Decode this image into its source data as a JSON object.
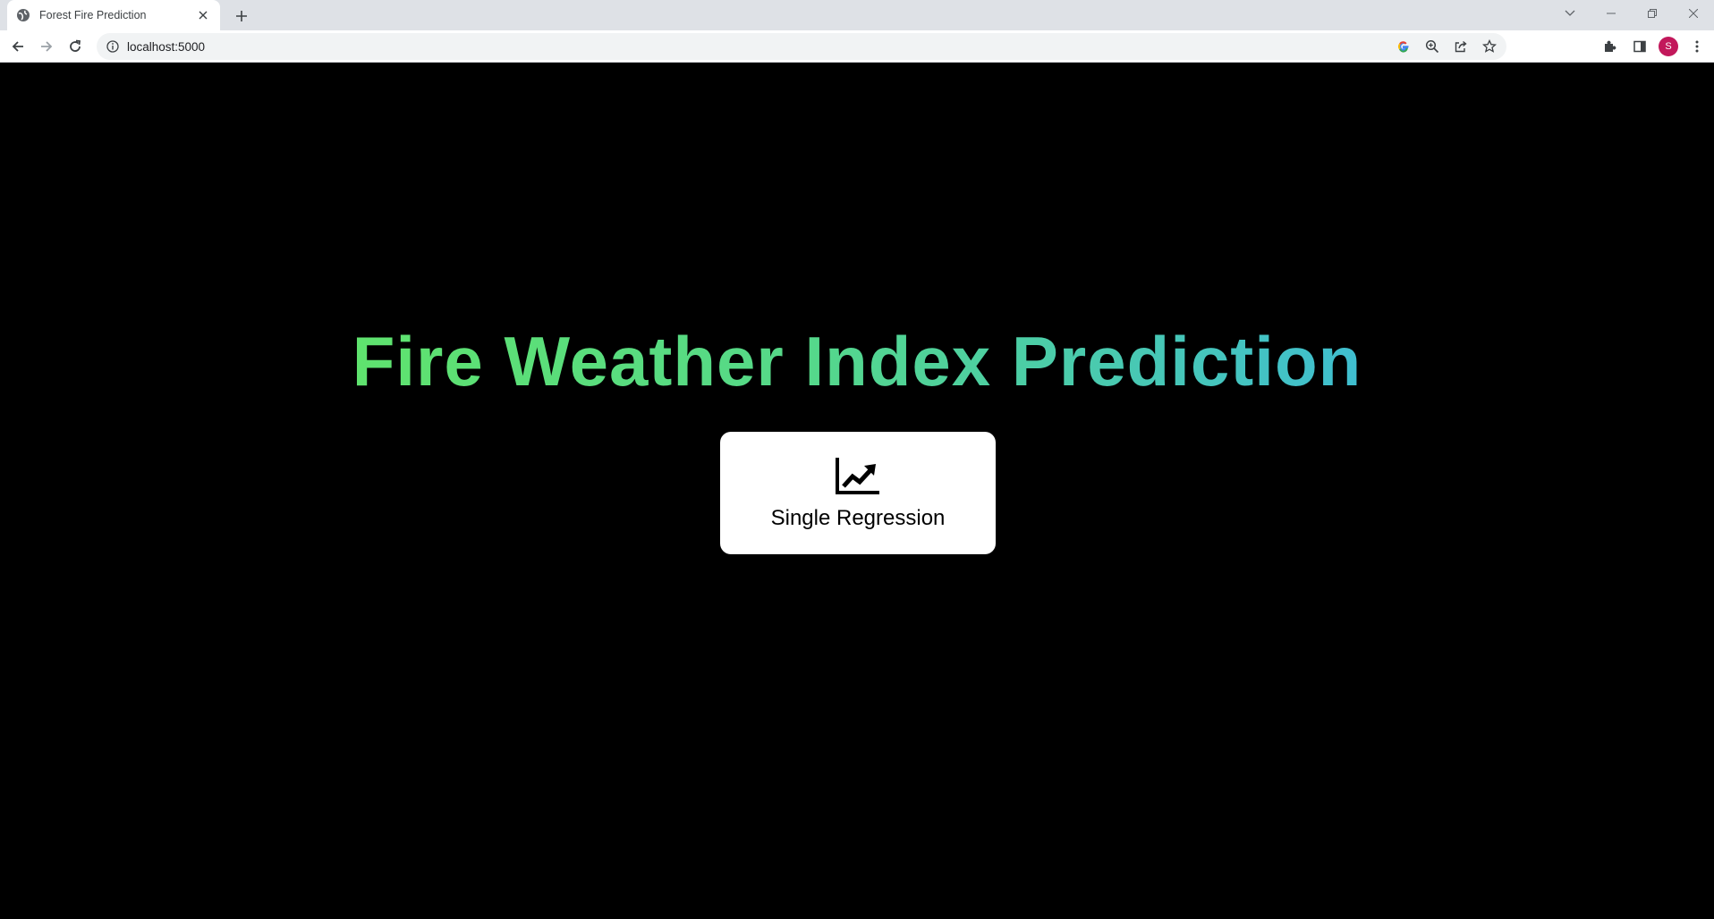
{
  "browser": {
    "tab_title": "Forest Fire Prediction",
    "url": "localhost:5000",
    "avatar_initial": "S"
  },
  "main": {
    "heading": "Fire Weather Index Prediction",
    "card": {
      "label": "Single Regression",
      "icon": "chart-line-up-icon"
    }
  },
  "colors": {
    "background": "#000000",
    "heading_gradient_start": "#5fe36e",
    "heading_gradient_end": "#3fbed0",
    "card_background": "#ffffff",
    "avatar": "#c2185b"
  }
}
